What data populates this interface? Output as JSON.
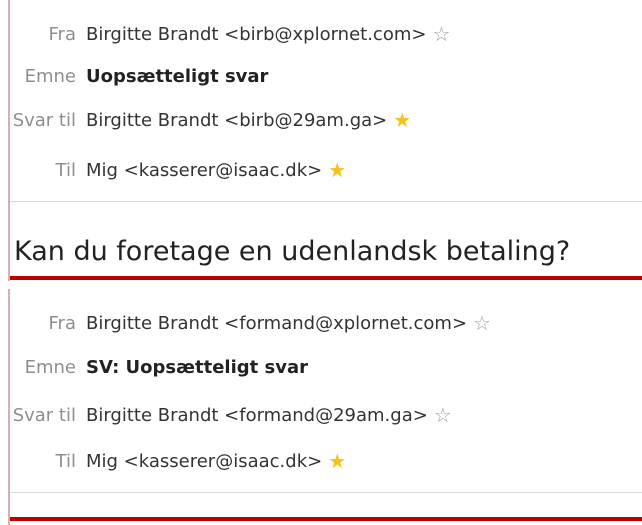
{
  "messages": [
    {
      "from": {
        "label": "Fra",
        "value": "Birgitte Brandt <birb@xplornet.com>",
        "star": "star-outline-icon"
      },
      "subject": {
        "label": "Emne",
        "value": "Uopsætteligt svar"
      },
      "reply_to": {
        "label": "Svar til",
        "value": "Birgitte Brandt <birb@29am.ga>",
        "star": "star-filled-icon"
      },
      "to": {
        "label": "Til",
        "value": "Mig <kasserer@isaac.dk>",
        "star": "star-filled-icon"
      },
      "body_preview": "Kan du foretage en udenlandsk betaling?"
    },
    {
      "from": {
        "label": "Fra",
        "value": "Birgitte Brandt <formand@xplornet.com>",
        "star": "star-outline-icon"
      },
      "subject": {
        "label": "Emne",
        "value": "SV: Uopsætteligt svar"
      },
      "reply_to": {
        "label": "Svar til",
        "value": "Birgitte Brandt <formand@29am.ga>",
        "star": "star-outline-icon"
      },
      "to": {
        "label": "Til",
        "value": "Mig <kasserer@isaac.dk>",
        "star": "star-filled-icon"
      }
    }
  ],
  "colors": {
    "accent_bar": "#c00000",
    "star_filled": "#f3c21b",
    "star_outline": "#9aa3ad"
  }
}
